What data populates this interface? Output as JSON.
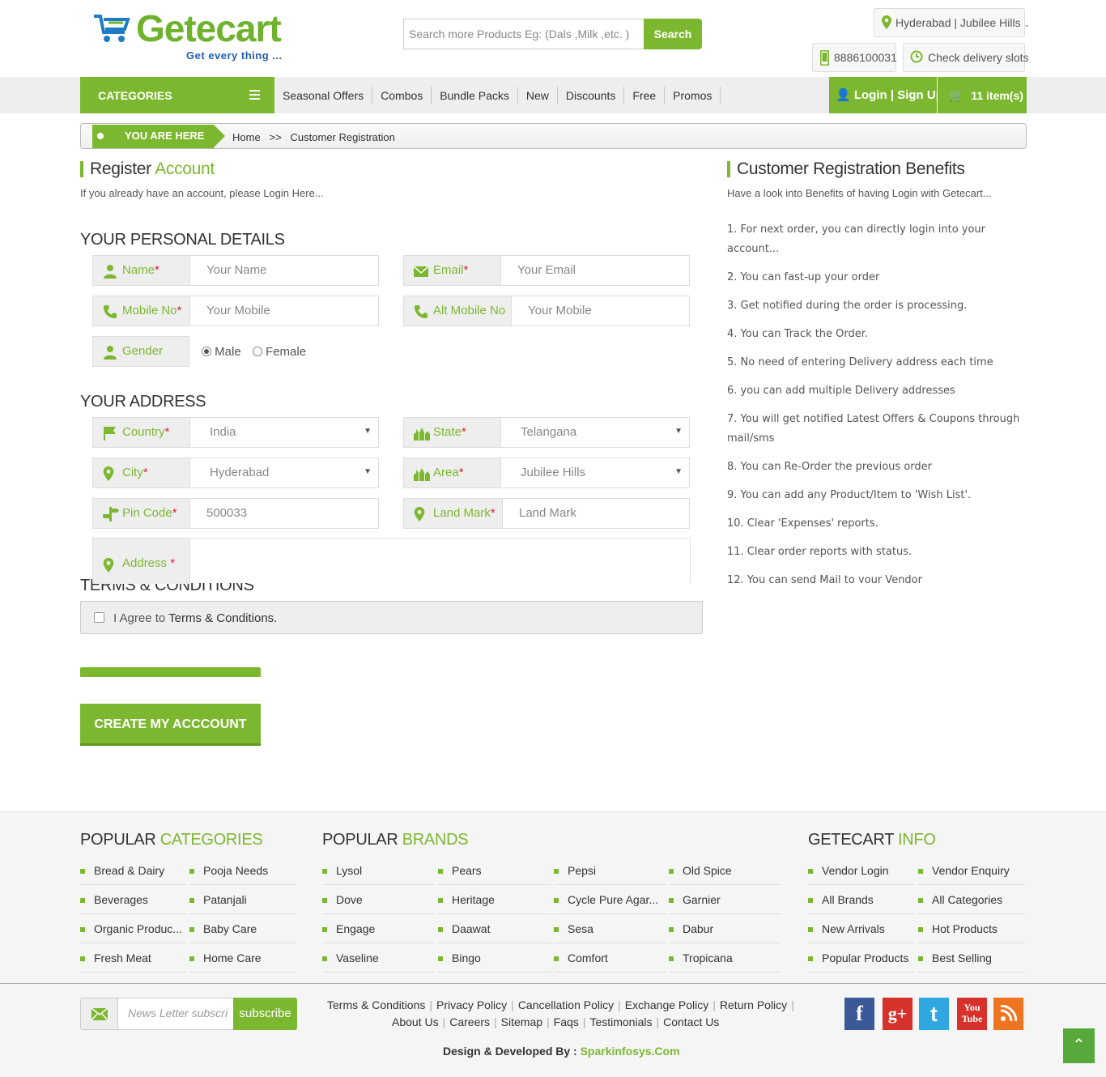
{
  "header": {
    "logo_text": "Getecart",
    "logo_tagline": "Get every thing ...",
    "search_placeholder": "Search more Products Eg: (Dals ,Milk ,etc. )",
    "search_button": "Search",
    "location": "Hyderabad | Jubilee Hills",
    "phone": "8886100031",
    "delivery_slots": "Check delivery slots"
  },
  "nav": {
    "categories_label": "CATEGORIES",
    "items": [
      "Seasonal Offers",
      "Combos",
      "Bundle Packs",
      "New",
      "Discounts",
      "Free",
      "Promos"
    ],
    "login_label": "Login | Sign Up",
    "cart_label": "11 item(s)"
  },
  "breadcrumb": {
    "tag": "YOU ARE HERE",
    "path": "Home   >>   Customer Registration"
  },
  "register": {
    "title_plain": "Register ",
    "title_accent": "Account",
    "subtitle": "If you already have an account, please Login Here...",
    "personal_heading": "YOUR PERSONAL DETAILS",
    "address_heading": "YOUR ADDRESS",
    "fields": {
      "name": {
        "label": "Name",
        "placeholder": "Your Name"
      },
      "email": {
        "label": "Email",
        "placeholder": "Your Email"
      },
      "mobile": {
        "label": "Mobile No",
        "placeholder": "Your Mobile"
      },
      "alt_mobile": {
        "label": "Alt Mobile No",
        "placeholder": "Your Mobile"
      },
      "gender": {
        "label": "Gender",
        "option_male": "Male",
        "option_female": "Female",
        "selected": "Male"
      },
      "country": {
        "label": "Country",
        "value": "India"
      },
      "state": {
        "label": "State",
        "value": "Telangana"
      },
      "city": {
        "label": "City",
        "value": "Hyderabad"
      },
      "area": {
        "label": "Area",
        "value": "Jubilee Hills"
      },
      "pincode": {
        "label": "Pin Code",
        "value": "500033"
      },
      "landmark": {
        "label": "Land Mark",
        "placeholder": "Land Mark"
      },
      "address": {
        "label": "Address "
      }
    },
    "required_star": "*",
    "terms_heading": "TERMS & CONDITIONS",
    "terms_prefix": "I Agree to ",
    "terms_link": "Terms & Conditions.",
    "create_button": "CREATE MY ACCCOUNT"
  },
  "benefits": {
    "title": "Customer Registration Benefits",
    "subtitle": "Have a look into Benefits of having Login with Getecart...",
    "items": [
      "1. For next order, you can directly login into your account...",
      "2. You can fast-up your order",
      "3. Get notified during the order is processing.",
      "4. You can Track the Order.",
      "5. No need of entering Delivery address each time",
      "6. you can add multiple Delivery addresses",
      "7. You will get notified Latest Offers & Coupons through mail/sms",
      "8. You can Re-Order the previous order",
      "9. You can add any Product/Item to 'Wish List'.",
      "10. Clear 'Expenses' reports.",
      "11. Clear order reports with status.",
      "12. You can send Mail to your Vendor"
    ]
  },
  "footer": {
    "categories_head_plain": "POPULAR ",
    "categories_head_accent": "CATEGORIES",
    "categories": [
      "Bread & Dairy",
      "Pooja Needs",
      "Beverages",
      "Patanjali",
      "Organic Produc...",
      "Baby Care",
      "Fresh Meat",
      "Home Care"
    ],
    "brands_head_plain": "POPULAR ",
    "brands_head_accent": "BRANDS",
    "brands": [
      "Lysol",
      "Pears",
      "Pepsi",
      "Old Spice",
      "Dove",
      "Heritage",
      "Cycle Pure Agar...",
      "Garnier",
      "Engage",
      "Daawat",
      "Sesa",
      "Dabur",
      "Vaseline",
      "Bingo",
      "Comfort",
      "Tropicana"
    ],
    "info_head_plain": "GETECART ",
    "info_head_accent": "INFO",
    "info": [
      "Vendor Login",
      "Vendor Enquiry",
      "All Brands",
      "All Categories",
      "New Arrivals",
      "Hot Products",
      "Popular Products",
      "Best Selling"
    ],
    "newsletter_placeholder": "News Letter subscri",
    "subscribe_button": "subscribe",
    "policy_row1": [
      "Terms & Conditions",
      "Privacy Policy",
      "Cancellation Policy",
      "Exchange Policy",
      "Return Policy"
    ],
    "policy_row2": [
      "About Us",
      "Careers",
      "Sitemap",
      "Faqs",
      "Testimonials",
      "Contact Us"
    ],
    "credit_prefix": "Design & Developed By : ",
    "credit_link": "Sparkinfosys.Com",
    "social": {
      "facebook": "f",
      "googleplus": "g+",
      "twitter": "t",
      "youtube_1": "You",
      "youtube_2": "Tube"
    },
    "colors": {
      "accent": "#7cb82f",
      "facebook": "#3b5998",
      "googleplus": "#d6322b",
      "twitter": "#2fa7e0",
      "youtube": "#d6322b",
      "rss": "#f0731f"
    }
  }
}
